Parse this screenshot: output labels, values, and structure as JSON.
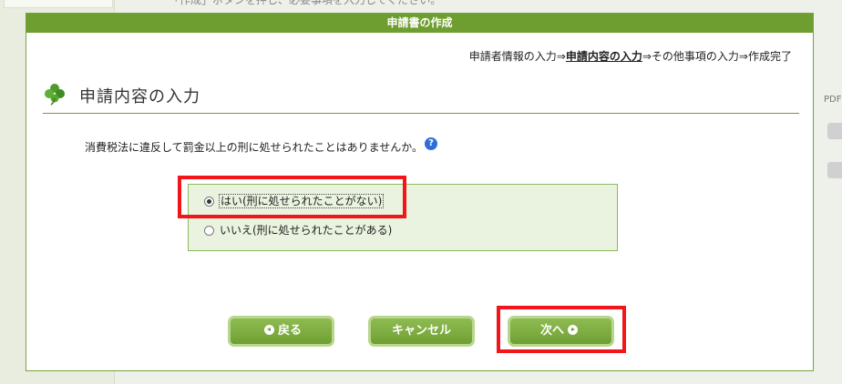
{
  "background": {
    "top_text": "「作成」ボタンを押し、必要事項を入力してください。",
    "right_label": "PDF"
  },
  "dialog": {
    "title": "申請書の作成",
    "steps": {
      "before": "申請者情報の入力⇒",
      "current": "申請内容の入力",
      "after": "⇒その他事項の入力⇒作成完了"
    },
    "section_title": "申請内容の入力",
    "question": "消費税法に違反して罰金以上の刑に処せられたことはありませんか。",
    "help_icon_text": "?",
    "options": [
      {
        "label": "はい(刑に処せられたことがない)",
        "checked": true
      },
      {
        "label": "いいえ(刑に処せられたことがある)",
        "checked": false
      }
    ],
    "buttons": {
      "back": "戻る",
      "cancel": "キャンセル",
      "next": "次へ"
    }
  },
  "colors": {
    "accent_green": "#6e9e30",
    "highlight_red": "#f2161a",
    "option_bg": "#eaf3df"
  }
}
